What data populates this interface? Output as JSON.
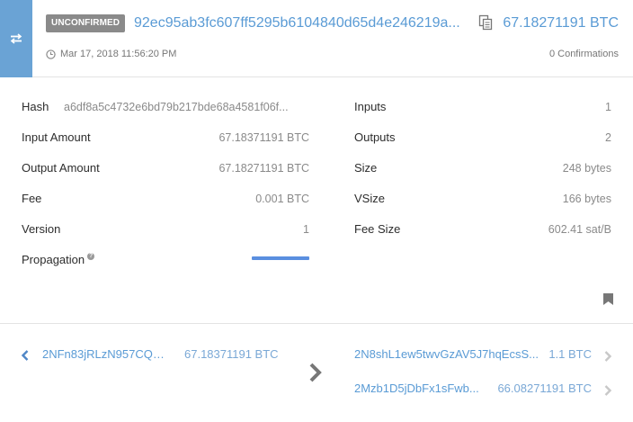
{
  "header": {
    "status_badge": "UNCONFIRMED",
    "txid": "92ec95ab3fc607ff5295b6104840d65d4e246219a...",
    "amount": "67.18271191 BTC",
    "date": "Mar 17, 2018 11:56:20 PM",
    "confirmations": "0 Confirmations",
    "tab_icon": "transfer-arrows-icon",
    "accent_color": "#6aa3d5"
  },
  "details": {
    "left": [
      {
        "label": "Hash",
        "value": "a6df8a5c4732e6bd79b217bde68a4581f06f..."
      },
      {
        "label": "Input Amount",
        "value": "67.18371191 BTC"
      },
      {
        "label": "Output Amount",
        "value": "67.18271191 BTC"
      },
      {
        "label": "Fee",
        "value": "0.001 BTC"
      },
      {
        "label": "Version",
        "value": "1"
      },
      {
        "label": "Propagation",
        "value": ""
      }
    ],
    "right": [
      {
        "label": "Inputs",
        "value": "1"
      },
      {
        "label": "Outputs",
        "value": "2"
      },
      {
        "label": "Size",
        "value": "248 bytes"
      },
      {
        "label": "VSize",
        "value": "166 bytes"
      },
      {
        "label": "Fee Size",
        "value": "602.41 sat/B"
      }
    ],
    "help_icon": "?"
  },
  "io": {
    "inputs": [
      {
        "address": "2NFn83jRLzN957CQcj...",
        "amount": "67.18371191 BTC"
      }
    ],
    "outputs": [
      {
        "address": "2N8shL1ew5twvGzAV5J7hqEcsS...",
        "amount": "1.1 BTC"
      },
      {
        "address": "2Mzb1D5jDbFx1sFwb...",
        "amount": "66.08271191 BTC"
      }
    ]
  }
}
